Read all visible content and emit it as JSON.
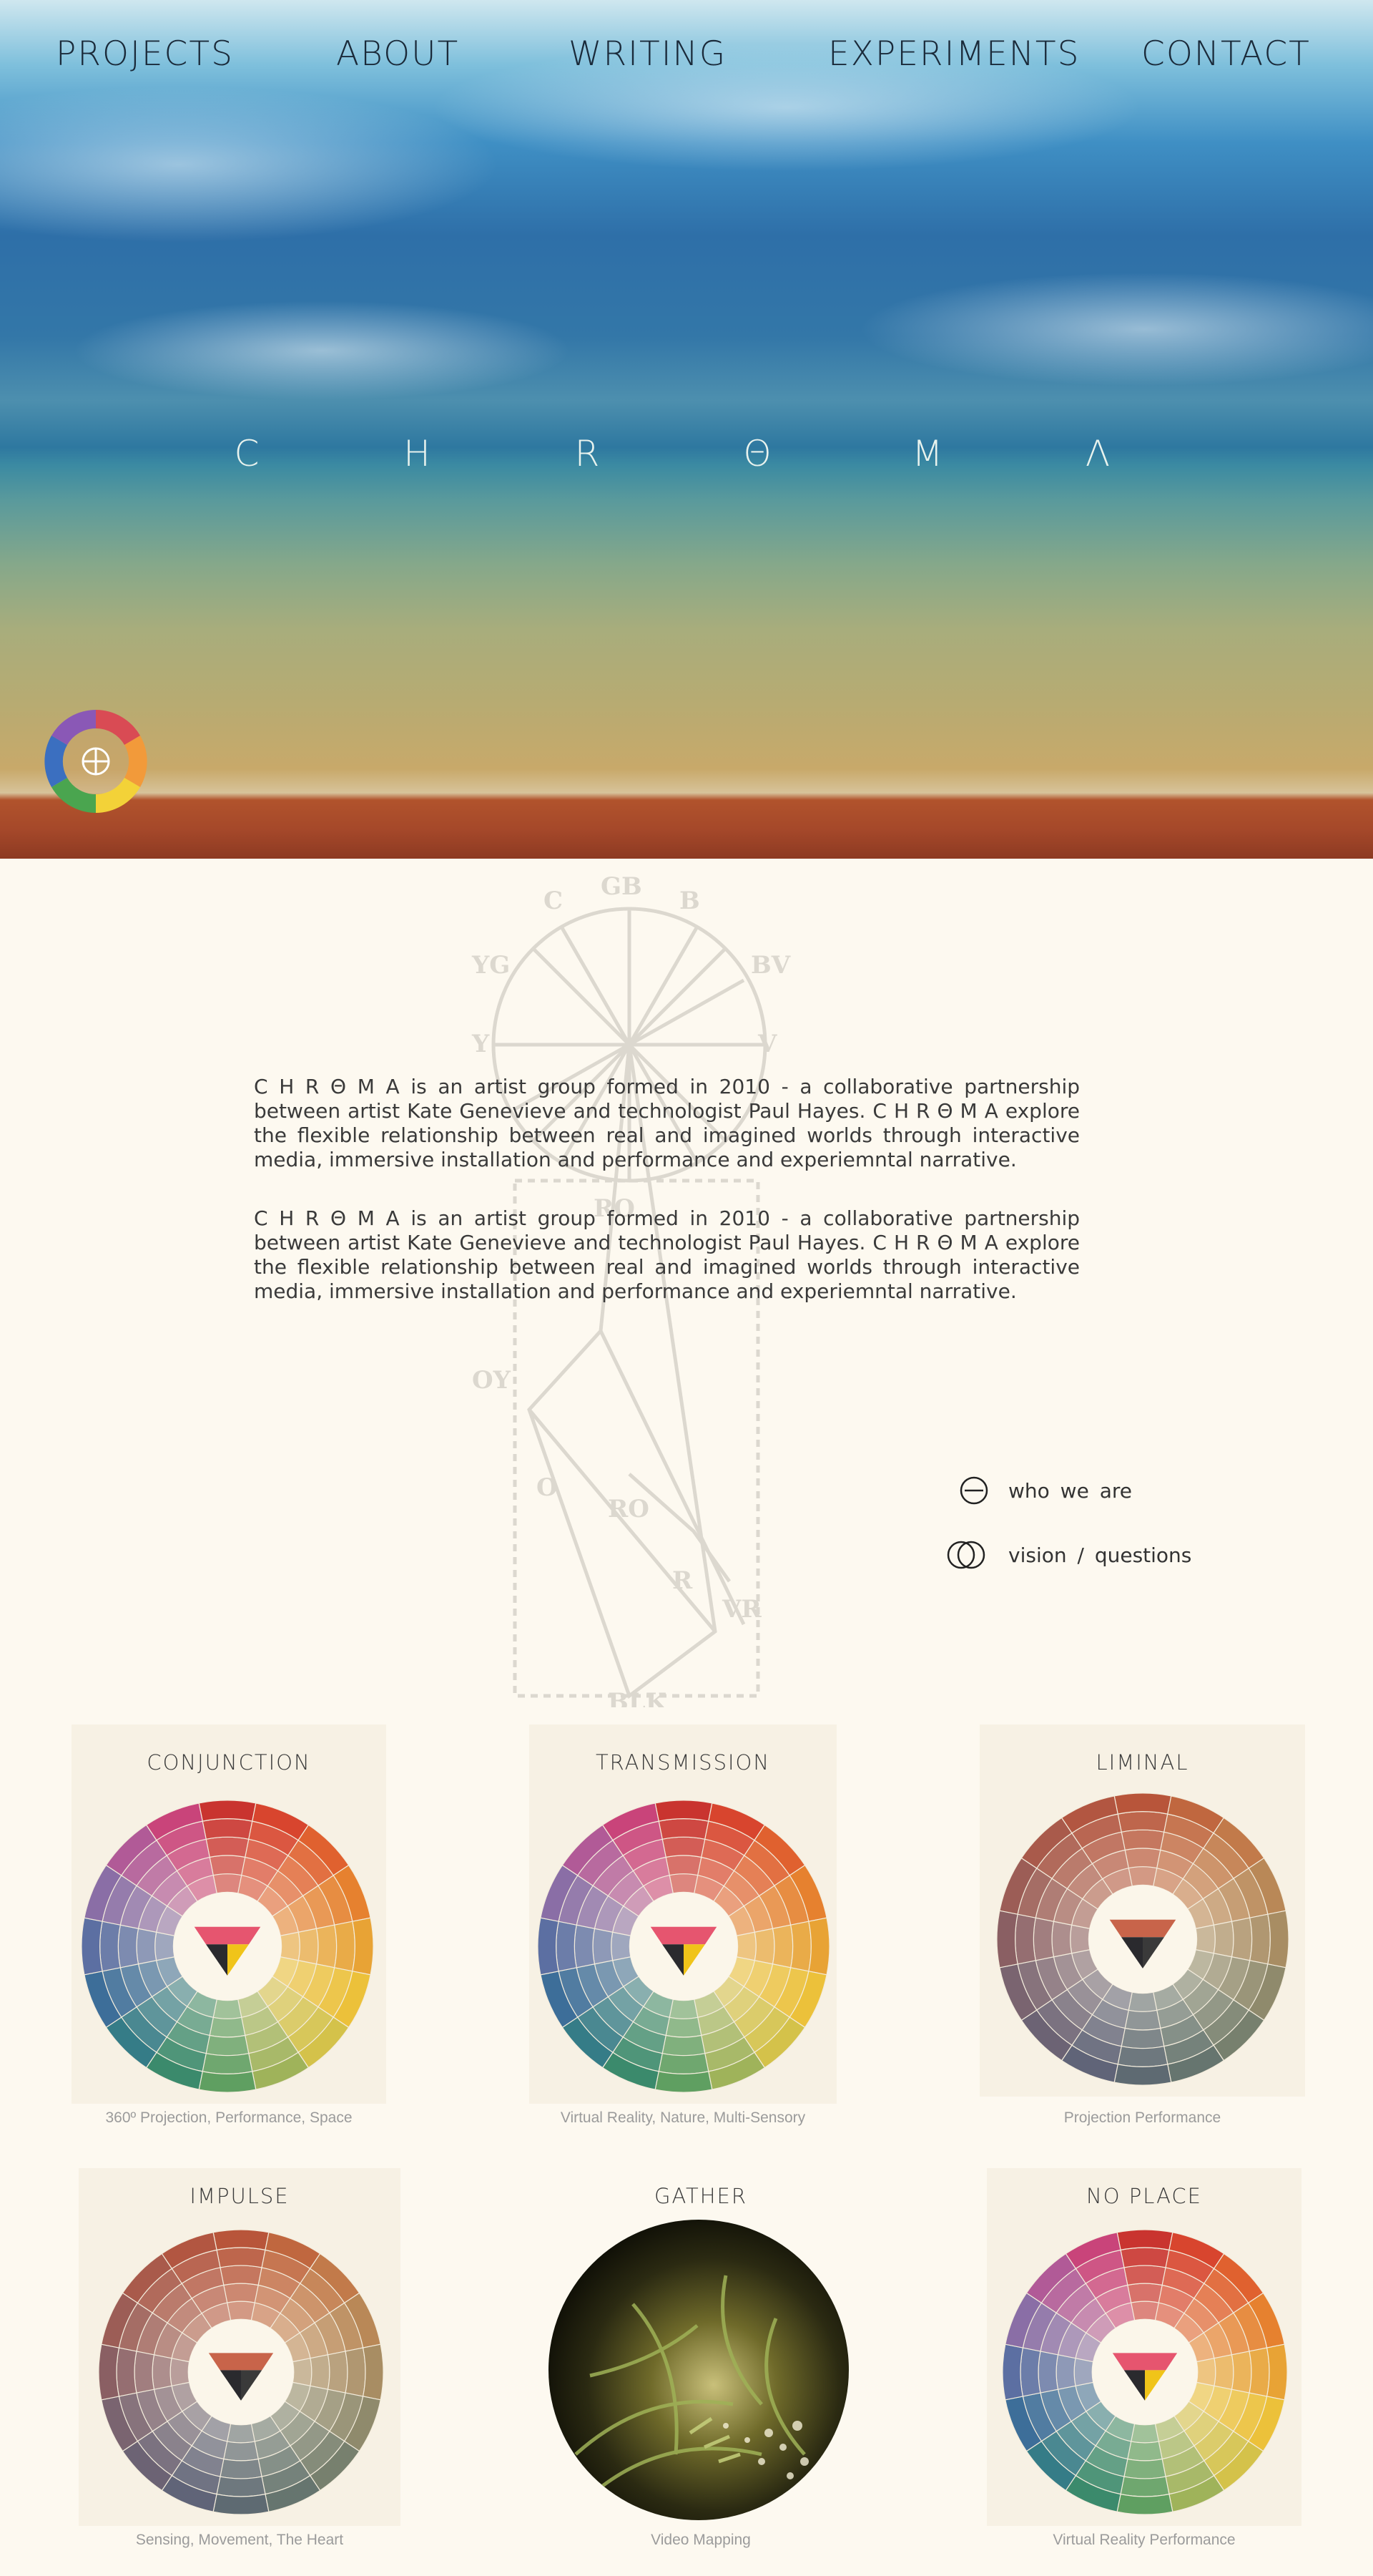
{
  "nav": {
    "items": [
      "PROJECTS",
      "ABOUT",
      "WRITING",
      "EXPERIMENTS",
      "CONTACT"
    ]
  },
  "hero": {
    "letters": [
      "C",
      "H",
      "R",
      "Θ",
      "M",
      "Λ"
    ]
  },
  "about": {
    "paragraphs": [
      "C H R Θ M A is an artist group formed in 2010 - a collaborative partnership between artist Kate Genevieve and technologist Paul Hayes. C H R Θ M A explore the flexible relationship between real and imagined worlds through interactive media, immersive installation and performance and experiemntal narrative.",
      "C H R Θ M A is an artist group formed in 2010 - a collaborative partnership between artist Kate Genevieve and technologist Paul Hayes. C H R Θ M A explore the flexible relationship between real and imagined worlds through interactive media, immersive installation and performance and experiemntal narrative."
    ],
    "links": [
      {
        "label": "who we are",
        "icon": "theta-circle-icon"
      },
      {
        "label": "vision / questions",
        "icon": "double-circle-icon"
      }
    ]
  },
  "projects": [
    {
      "title": "CONJUNCTION",
      "tags": "360º Projection, Performance, Space",
      "image": "color-wheel-vivid"
    },
    {
      "title": "TRANSMISSION",
      "tags": "Virtual Reality, Nature, Multi-Sensory",
      "image": "color-wheel-vivid"
    },
    {
      "title": "LIMINAL",
      "tags": "Projection Performance",
      "image": "color-wheel-muted"
    },
    {
      "title": "IMPULSE",
      "tags": "Sensing, Movement, The Heart",
      "image": "color-wheel-muted"
    },
    {
      "title": "GATHER",
      "tags": "Video Mapping",
      "image": "forest-photo"
    },
    {
      "title": "NO PLACE",
      "tags": "Virtual Reality Performance",
      "image": "color-wheel-vivid"
    }
  ],
  "colors": {
    "background": "#fdf9f0",
    "nav_text": "#1a2a3a",
    "body_text": "#3a3a3a",
    "tag_text": "#9b9b9b"
  }
}
